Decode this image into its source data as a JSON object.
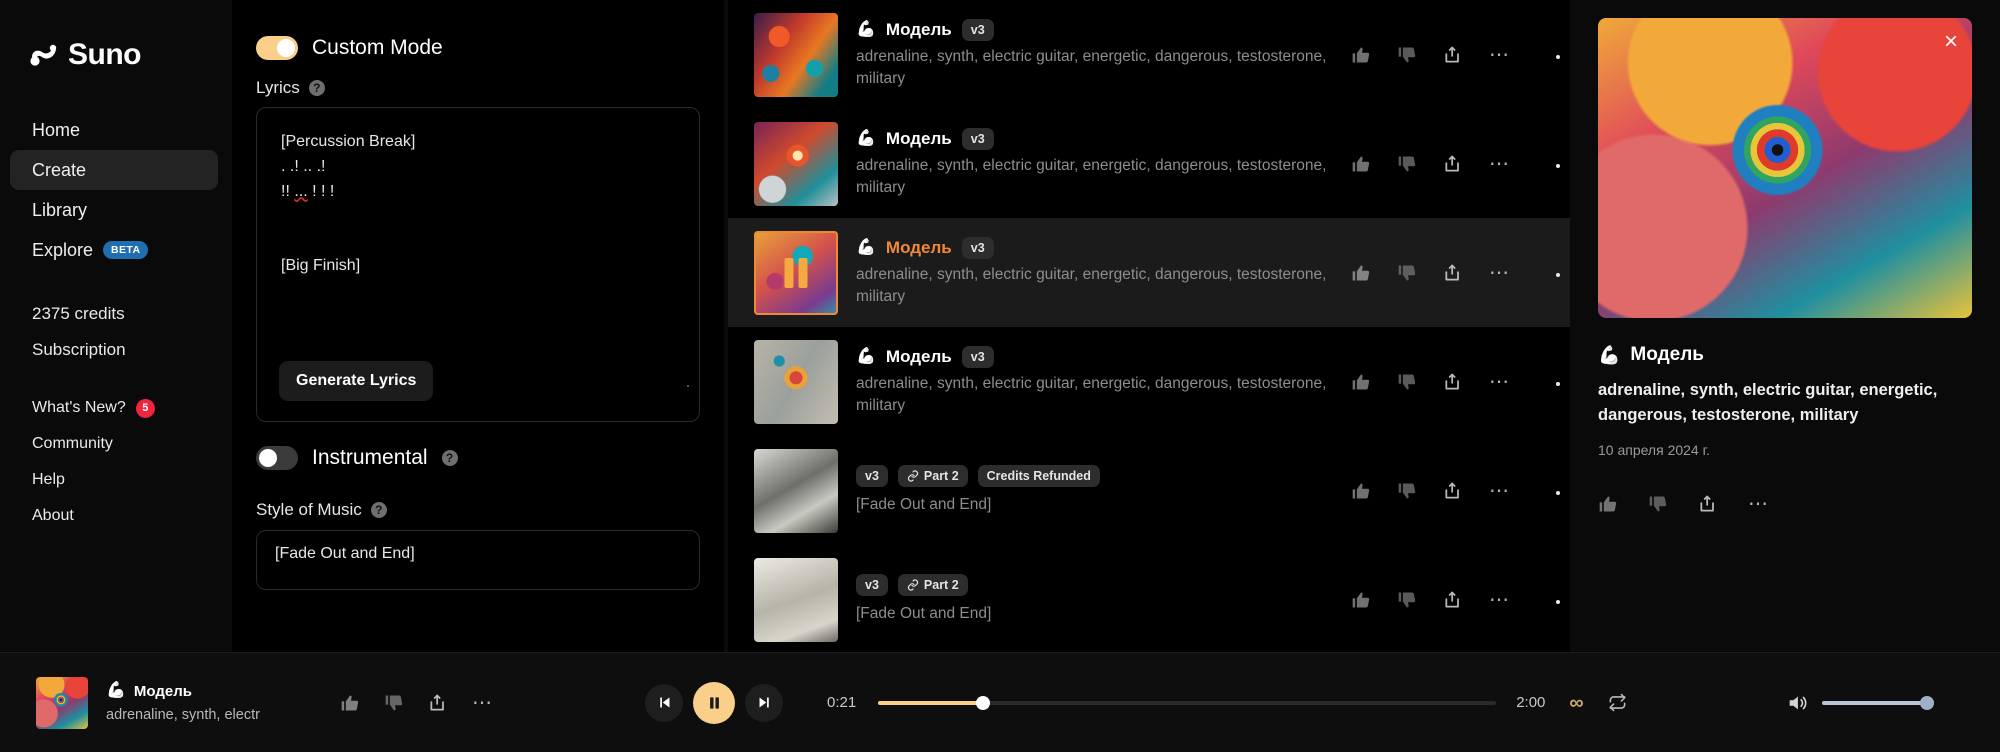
{
  "brand": {
    "name": "Suno"
  },
  "sidebar": {
    "nav": [
      {
        "label": "Home",
        "active": false
      },
      {
        "label": "Create",
        "active": true
      },
      {
        "label": "Library",
        "active": false
      },
      {
        "label": "Explore",
        "active": false,
        "badge": "BETA"
      }
    ],
    "credits": "2375 credits",
    "subscription": "Subscription",
    "links": [
      {
        "label": "What's New?",
        "count": "5"
      },
      {
        "label": "Community"
      },
      {
        "label": "Help"
      },
      {
        "label": "About"
      }
    ]
  },
  "create": {
    "custom_mode_label": "Custom Mode",
    "custom_mode_on": true,
    "lyrics_label": "Lyrics",
    "lyrics_line1": "[Percussion Break]",
    "lyrics_line2": ". .! .. .!",
    "lyrics_line3_a": "!! ",
    "lyrics_line3_b": "...",
    "lyrics_line3_c": " ! ! !",
    "lyrics_line4": "[Big Finish]",
    "generate_lyrics_label": "Generate Lyrics",
    "instrumental_label": "Instrumental",
    "instrumental_on": false,
    "style_label": "Style of Music",
    "style_value": "[Fade Out and End]",
    "help_glyph": "?"
  },
  "songs": [
    {
      "title": "Модель",
      "version": "v3",
      "desc": "adrenaline, synth, electric guitar, energetic, dangerous, testosterone, military",
      "art": "art-a",
      "selected": false,
      "muscle": "💪"
    },
    {
      "title": "Модель",
      "version": "v3",
      "desc": "adrenaline, synth, electric guitar, energetic, dangerous, testosterone, military",
      "art": "art-b",
      "selected": false,
      "muscle": "💪"
    },
    {
      "title": "Модель",
      "version": "v3",
      "desc": "adrenaline, synth, electric guitar, energetic, dangerous, testosterone, military",
      "art": "art-c",
      "selected": true,
      "muscle": "💪"
    },
    {
      "title": "Модель",
      "version": "v3",
      "desc": "adrenaline, synth, electric guitar, energetic, dangerous, testosterone, military",
      "art": "art-d",
      "selected": false,
      "muscle": "💪"
    },
    {
      "title": "",
      "version": "v3",
      "part_label": "Part 2",
      "refund_label": "Credits Refunded",
      "desc": "[Fade Out and End]",
      "art": "art-e",
      "selected": false
    },
    {
      "title": "",
      "version": "v3",
      "part_label": "Part 2",
      "desc": "[Fade Out and End]",
      "art": "art-f",
      "selected": false
    }
  ],
  "detail": {
    "title": "Модель",
    "desc": "adrenaline, synth, electric guitar, energetic, dangerous, testosterone, military",
    "date": "10 апреля 2024 г.",
    "close_label": "×",
    "muscle": "💪"
  },
  "player": {
    "title": "Модель",
    "desc": "adrenaline, synth, electr",
    "current_time": "0:21",
    "total_time": "2:00",
    "progress_percent": 17,
    "volume_percent": 100,
    "playing": true,
    "muscle": "💪",
    "infinity_glyph": "∞"
  }
}
